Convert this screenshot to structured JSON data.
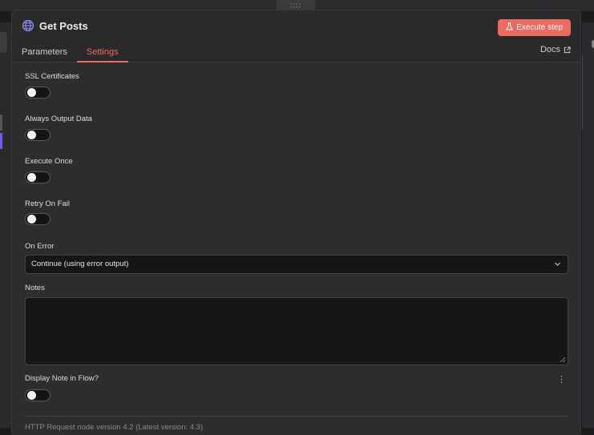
{
  "canvas": {
    "drag_handle": "∷∷"
  },
  "header": {
    "title": "Get Posts",
    "execute_label": "Execute step",
    "docs_label": "Docs",
    "tabs": [
      {
        "label": "Parameters",
        "active": false
      },
      {
        "label": "Settings",
        "active": true
      }
    ]
  },
  "settings": {
    "ssl": {
      "label": "SSL Certificates",
      "enabled": false
    },
    "always_output": {
      "label": "Always Output Data",
      "enabled": false
    },
    "execute_once": {
      "label": "Execute Once",
      "enabled": false
    },
    "retry_on_fail": {
      "label": "Retry On Fail",
      "enabled": false
    },
    "on_error": {
      "label": "On Error",
      "value": "Continue (using error output)"
    },
    "notes": {
      "label": "Notes",
      "value": ""
    },
    "display_note": {
      "label": "Display Note in Flow?",
      "enabled": false
    }
  },
  "footer": {
    "version_text": "HTTP Request node version 4.2 (Latest version: 4.3)"
  },
  "colors": {
    "accent": "#ea6b5f",
    "panel": "#2a2a2a",
    "input_bg": "#161616"
  },
  "icons": {
    "title": "globe-icon",
    "execute": "flask-icon",
    "docs": "external-link-icon",
    "select": "chevron-down-icon",
    "more": "kebab-menu-icon"
  }
}
